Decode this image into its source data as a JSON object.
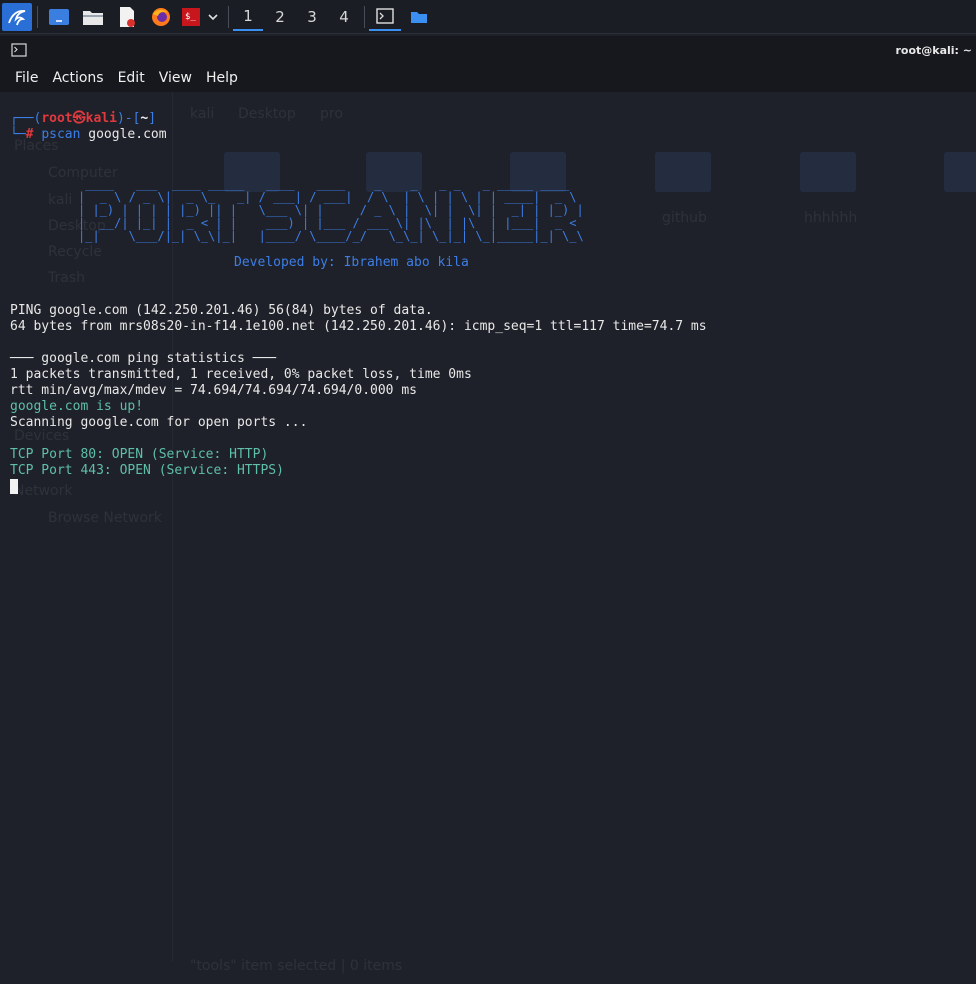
{
  "taskbar": {
    "workspaces": [
      "1",
      "2",
      "3",
      "4"
    ]
  },
  "window": {
    "title": "root@kali: ~"
  },
  "menu": [
    "File",
    "Actions",
    "Edit",
    "View",
    "Help"
  ],
  "prompt": {
    "open": "┌──(",
    "user_host": "root㉿kali",
    "mid": ")-[",
    "dir": "~",
    "close": "]",
    "second_prefix": "└─",
    "hash": "#",
    "command": "pscan",
    "argument": " google.com"
  },
  "banner": {
    "art": " ____   ___  ____ _____   ____   ____    _    _   _ _   _ _____ ____  \n|  _ \\ / _ \\|  _ \\_   _| / ___| / ___|  / \\  | \\ | | \\ | | ____|  _ \\ \n| |_) | | | | |_) || |   \\___ \\| |     / _ \\ |  \\| |  \\| |  _| | |_) |\n|  __/| |_| |  _ < | |    ___) | |___ / ___ \\| |\\  | |\\  | |___|  _ < \n|_|    \\___/|_| \\_\\|_|   |____/ \\____/_/   \\_\\_| \\_|_| \\_|_____|_| \\_\\",
    "credit": "Developed by: Ibrahem abo kila"
  },
  "output": {
    "ping_header": "PING google.com (142.250.201.46) 56(84) bytes of data.",
    "ping_reply": "64 bytes from mrs08s20-in-f14.1e100.net (142.250.201.46): icmp_seq=1 ttl=117 time=74.7 ms",
    "stats_header": "─── google.com ping statistics ───",
    "stats_packets": "1 packets transmitted, 1 received, 0% packet loss, time 0ms",
    "stats_rtt": "rtt min/avg/max/mdev = 74.694/74.694/74.694/0.000 ms",
    "host_up": "google.com is up!",
    "scanning": "Scanning google.com for open ports ...",
    "port_80": "TCP Port 80: OPEN (Service: HTTP)",
    "port_443": "TCP Port 443: OPEN (Service: HTTPS)"
  },
  "background_ghost": {
    "sidebar": [
      "Places",
      "Computer",
      "kali",
      "Desktop",
      "Recycle",
      "Trash",
      "Devices",
      "Network",
      "Browse Network"
    ],
    "folders": [
      "github",
      "hhhhhh"
    ],
    "path": [
      "kali",
      "Desktop",
      "pro"
    ],
    "status": "\"tools\" item selected | 0 items"
  },
  "colors": {
    "accent": "#3b8ff0",
    "prompt_blue": "#3d7ee6",
    "prompt_red": "#e0393e",
    "success_green": "#5fbfa8",
    "terminal_bg": "#1e2129"
  }
}
